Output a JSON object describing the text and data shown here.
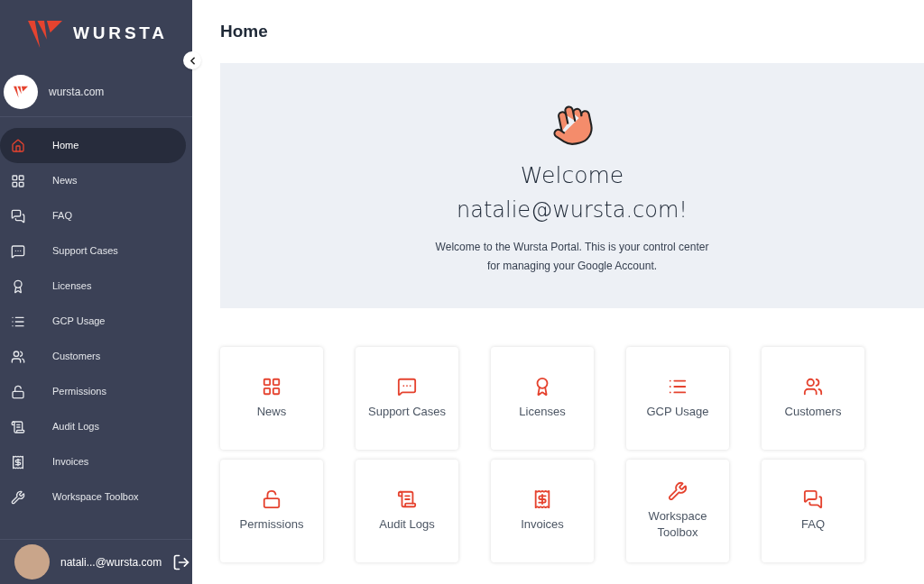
{
  "brand": {
    "name": "WURSTA"
  },
  "org": {
    "name": "wursta.com"
  },
  "nav": [
    {
      "label": "Home",
      "selected": true
    },
    {
      "label": "News",
      "selected": false
    },
    {
      "label": "FAQ",
      "selected": false
    },
    {
      "label": "Support Cases",
      "selected": false
    },
    {
      "label": "Licenses",
      "selected": false
    },
    {
      "label": "GCP Usage",
      "selected": false
    },
    {
      "label": "Customers",
      "selected": false
    },
    {
      "label": "Permissions",
      "selected": false
    },
    {
      "label": "Audit Logs",
      "selected": false
    },
    {
      "label": "Invoices",
      "selected": false
    },
    {
      "label": "Workspace Toolbox",
      "selected": false
    }
  ],
  "user": {
    "email": "natali...@wursta.com"
  },
  "page": {
    "title": "Home"
  },
  "welcome": {
    "heading": "Welcome",
    "email": "natalie@wursta.com!",
    "text": "Welcome to the Wursta Portal. This is your control center for managing your Google Account."
  },
  "tiles": [
    {
      "label": "News"
    },
    {
      "label": "Support Cases"
    },
    {
      "label": "Licenses"
    },
    {
      "label": "GCP Usage"
    },
    {
      "label": "Customers"
    },
    {
      "label": "Permissions"
    },
    {
      "label": "Audit Logs"
    },
    {
      "label": "Invoices"
    },
    {
      "label": "Workspace Toolbox"
    },
    {
      "label": "FAQ"
    }
  ]
}
